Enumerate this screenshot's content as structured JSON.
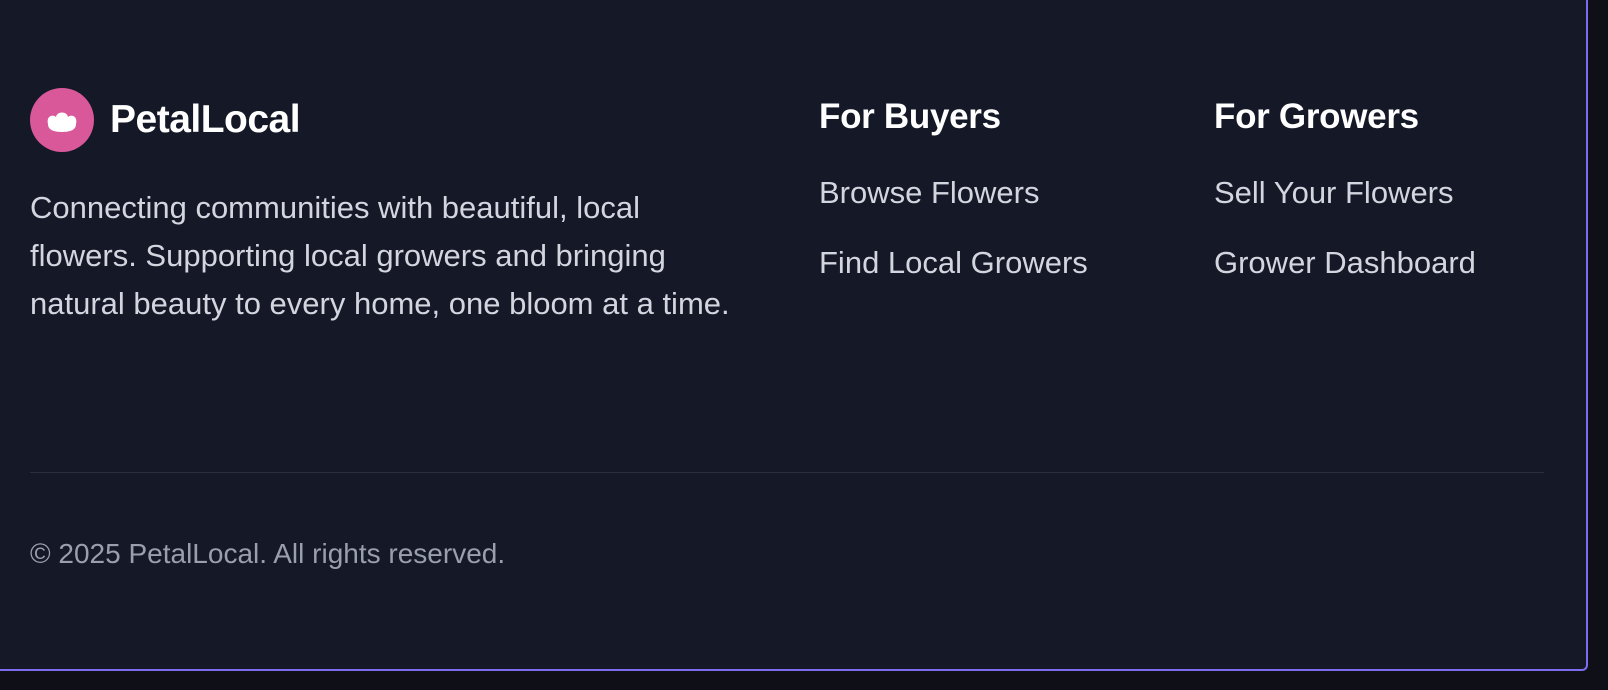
{
  "brand": {
    "name": "PetalLocal",
    "logo_icon": "flower-icon",
    "logo_color": "#d9589a",
    "tagline": "Connecting communities with beautiful, local flowers. Supporting local growers and bringing natural beauty to every home, one bloom at a time."
  },
  "columns": [
    {
      "heading": "For Buyers",
      "links": [
        "Browse Flowers",
        "Find Local Growers"
      ]
    },
    {
      "heading": "For Growers",
      "links": [
        "Sell Your Flowers",
        "Grower Dashboard"
      ]
    }
  ],
  "footer": {
    "copyright": "© 2025 PetalLocal. All rights reserved."
  },
  "colors": {
    "background": "#141827",
    "accent_border": "#7c6cf0",
    "heading": "#ffffff",
    "text": "#d3d6df",
    "muted": "#9a9fad"
  }
}
